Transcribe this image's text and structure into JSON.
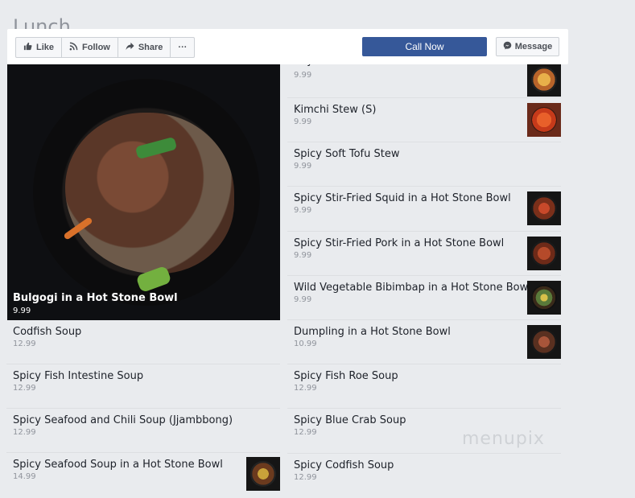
{
  "page": {
    "title": "Lunch"
  },
  "action_bar": {
    "like": "Like",
    "follow": "Follow",
    "share": "Share",
    "more": "···",
    "call_now": "Call Now",
    "message": "Message"
  },
  "featured": {
    "name": "Bulgogi in a Hot Stone Bowl",
    "price": "9.99"
  },
  "left_items": [
    {
      "name": "Codfish Soup",
      "price": "12.99"
    },
    {
      "name": "Spicy Fish Intestine Soup",
      "price": "12.99"
    },
    {
      "name": "Spicy Seafood and Chili Soup (Jjambbong)",
      "price": "12.99"
    },
    {
      "name": "Spicy Seafood Soup in a Hot Stone Bowl",
      "price": "14.99"
    }
  ],
  "right_items": [
    {
      "name": "Soybean Paste Stew",
      "price": "9.99"
    },
    {
      "name": "Kimchi Stew (S)",
      "price": "9.99"
    },
    {
      "name": "Spicy Soft Tofu Stew",
      "price": "9.99"
    },
    {
      "name": "Spicy Stir-Fried Squid in a Hot Stone Bowl",
      "price": "9.99"
    },
    {
      "name": "Spicy Stir-Fried Pork in a Hot Stone Bowl",
      "price": "9.99"
    },
    {
      "name": "Wild Vegetable Bibimbap in a Hot Stone Bowl",
      "price": "9.99"
    },
    {
      "name": "Dumpling in a Hot Stone Bowl",
      "price": "10.99"
    },
    {
      "name": "Spicy Fish Roe Soup",
      "price": "12.99"
    },
    {
      "name": "Spicy Blue Crab Soup",
      "price": "12.99"
    },
    {
      "name": "Spicy Codfish Soup",
      "price": "12.99"
    }
  ],
  "watermark": "menupix",
  "colors": {
    "accent": "#365899",
    "background": "#e9ebee",
    "divider": "#dddfe2"
  }
}
